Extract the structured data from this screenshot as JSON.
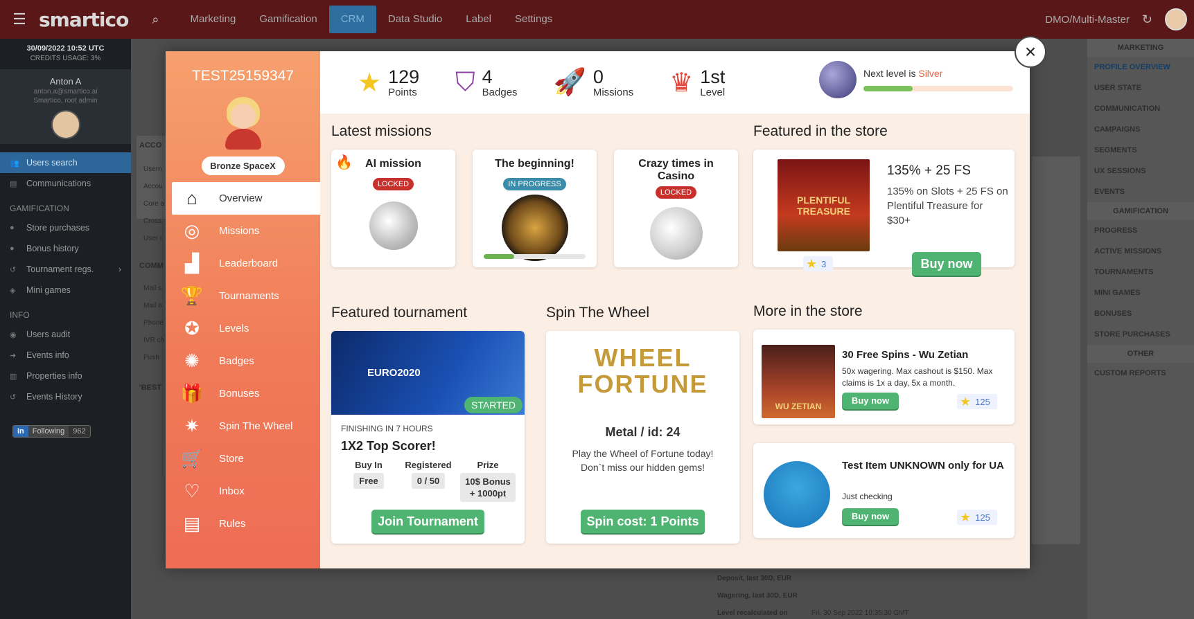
{
  "topbar": {
    "logo": "smartico",
    "nav": [
      "Marketing",
      "Gamification",
      "CRM",
      "Data Studio",
      "Label",
      "Settings"
    ],
    "active": "CRM",
    "env": "DMO/Multi-Master"
  },
  "leftbar": {
    "date": "30/09/2022 10:52 UTC",
    "credits": "CREDITS USAGE: 3%",
    "user_name": "Anton A",
    "user_mail": "anton.a@smartico.ai",
    "user_role": "Smartico, root admin",
    "items1": [
      "Users search",
      "Communications"
    ],
    "gam_head": "GAMIFICATION",
    "gam_items": [
      "Store purchases",
      "Bonus history",
      "Tournament regs.",
      "Mini games"
    ],
    "info_head": "INFO",
    "info_items": [
      "Users audit",
      "Events info",
      "Properties info",
      "Events History"
    ],
    "follow_label": "Following",
    "follow_count": "962"
  },
  "background": {
    "acc": "ACCO",
    "comm": "COMM",
    "best": "'BEST",
    "rows1": [
      "Usern",
      "Accou",
      "Core a",
      "Cross",
      "User r"
    ],
    "rows2": [
      "Mail s",
      "Mail a",
      "Phone",
      "IVR ch",
      "Push"
    ],
    "bottom": [
      "Deposit, last 30D, EUR",
      "Wagering, last 30D, EUR",
      "Level recalculated on"
    ],
    "bottom_val": "Fri, 30 Sep 2022 10:35:30 GMT"
  },
  "rightbar": {
    "marketing": "MARKETING",
    "m_items": [
      "PROFILE OVERVIEW",
      "USER STATE",
      "COMMUNICATION",
      "CAMPAIGNS",
      "SEGMENTS",
      "UX SESSIONS",
      "EVENTS"
    ],
    "gamification": "GAMIFICATION",
    "g_items": [
      "PROGRESS",
      "ACTIVE MISSIONS",
      "TOURNAMENTS",
      "MINI GAMES",
      "BONUSES",
      "STORE PURCHASES"
    ],
    "other": "OTHER",
    "o_items": [
      "CUSTOM REPORTS"
    ]
  },
  "modal": {
    "player_id": "TEST25159347",
    "level_name": "Bronze SpaceX",
    "menu": [
      "Overview",
      "Missions",
      "Leaderboard",
      "Tournaments",
      "Levels",
      "Badges",
      "Bonuses",
      "Spin The Wheel",
      "Store",
      "Inbox",
      "Rules"
    ],
    "stats": {
      "points": "129",
      "points_label": "Points",
      "badges": "4",
      "badges_label": "Badges",
      "missions": "0",
      "missions_label": "Missions",
      "level": "1st",
      "level_label": "Level",
      "next_prefix": "Next level is ",
      "next_level": "Silver",
      "next_progress": 0.33
    },
    "sections": {
      "missions": "Latest missions",
      "store": "Featured in the store",
      "tournament": "Featured tournament",
      "wheel": "Spin The Wheel",
      "more": "More in the store"
    },
    "missions": [
      {
        "title": "AI mission",
        "status": "LOCKED"
      },
      {
        "title": "The beginning!",
        "status": "IN PROGRESS",
        "progress": 0.3
      },
      {
        "title": "Crazy times in Casino",
        "status": "LOCKED"
      }
    ],
    "featured_store": {
      "title": "135% + 25 FS",
      "desc": "135% on Slots + 25 FS on Plentiful Treasure for $30+",
      "price": "3",
      "button": "Buy now",
      "art_text": "PLENTIFUL TREASURE"
    },
    "tournament": {
      "status": "STARTED",
      "finishing": "FINISHING IN 7 HOURS",
      "name": "1X2 Top Scorer!",
      "buyin_h": "Buy In",
      "buyin": "Free",
      "reg_h": "Registered",
      "reg": "0 / 50",
      "prize_h": "Prize",
      "prize": "10$ Bonus + 1000pt",
      "button": "Join Tournament",
      "art_text": "EURO2020"
    },
    "wheel": {
      "art_text": "WHEEL FORTUNE",
      "name": "Metal / id: 24",
      "desc": "Play the Wheel of Fortune today! Don`t miss our hidden gems!",
      "button": "Spin cost: 1 Points"
    },
    "more_store": [
      {
        "title": "30 Free Spins - Wu Zetian",
        "desc": "50x wagering. Max cashout is $150. Max claims is 1x a day, 5x a month.",
        "button": "Buy now",
        "price": "125",
        "art_text": "WU ZETIAN"
      },
      {
        "title": "Test Item UNKNOWN only for UA",
        "desc": "Just checking",
        "button": "Buy now",
        "price": "125"
      }
    ],
    "close": "×"
  }
}
